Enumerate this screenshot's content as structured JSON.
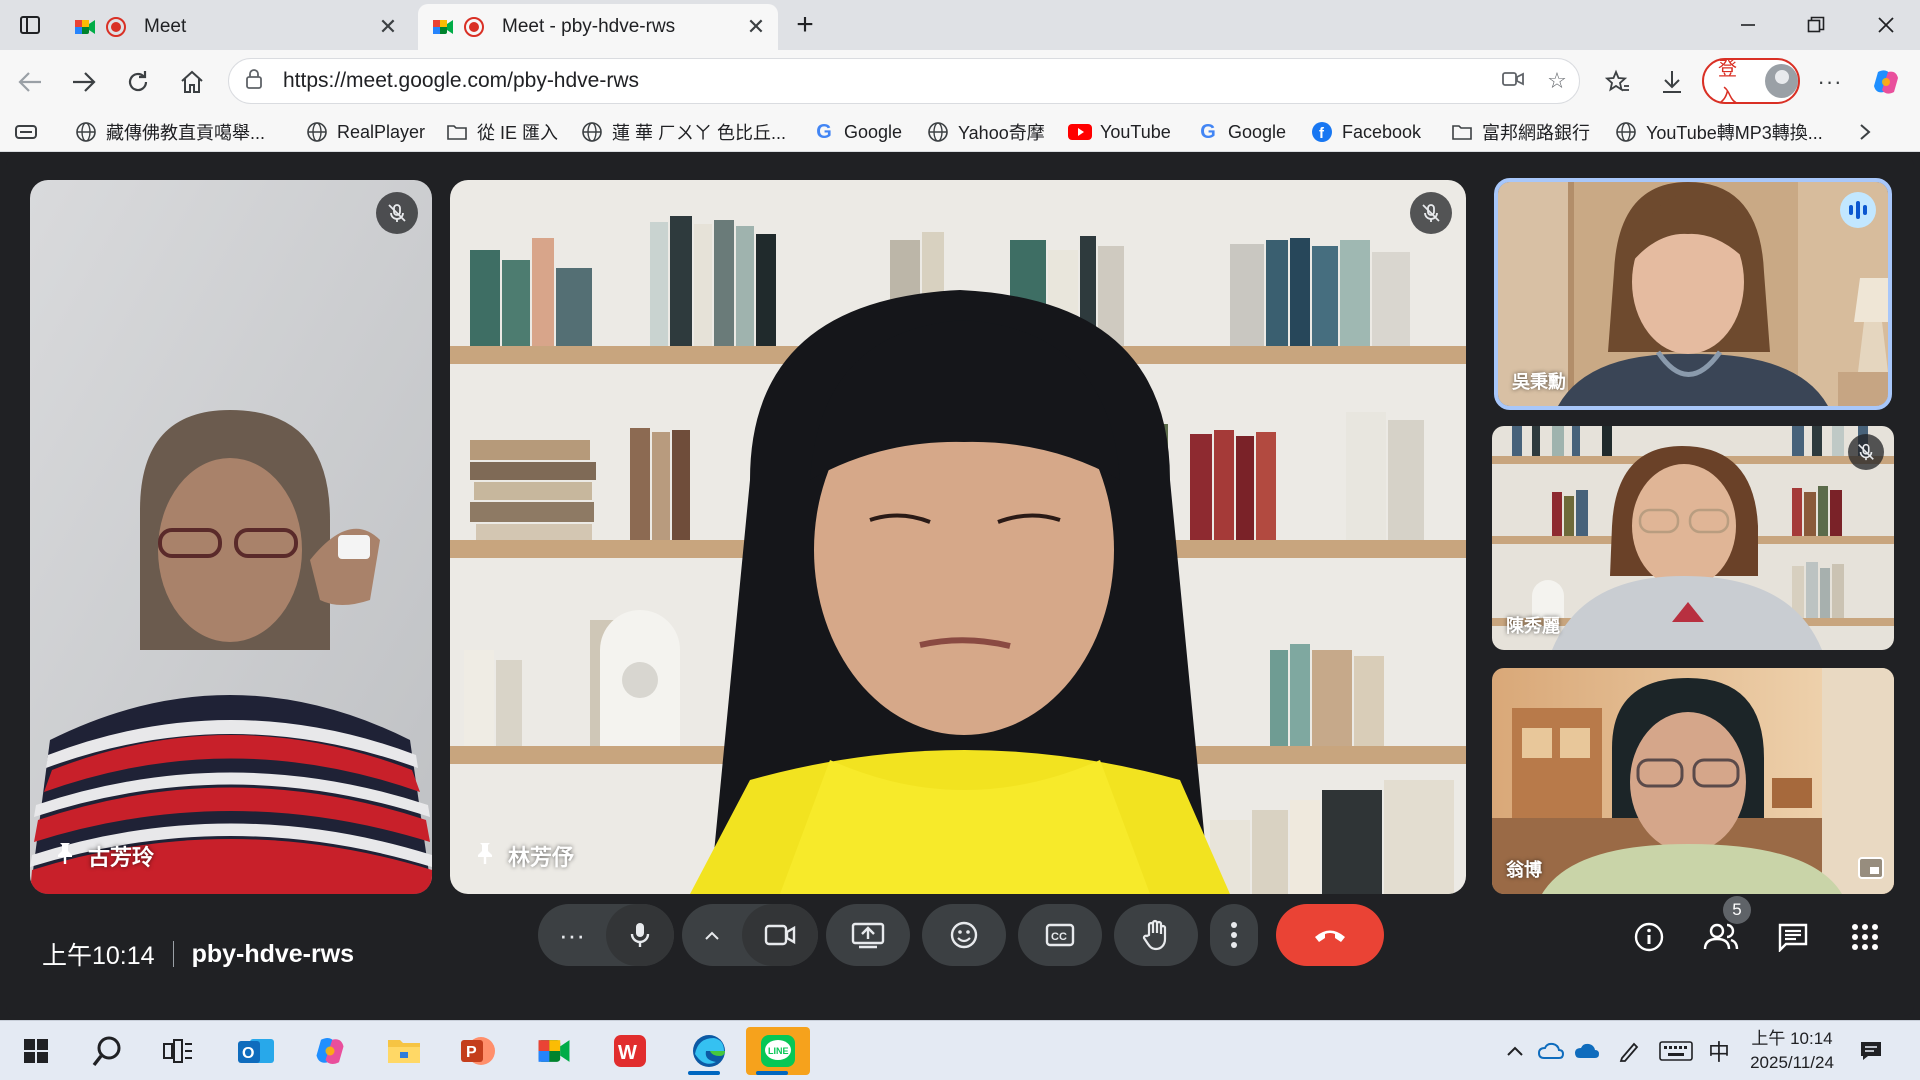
{
  "browser": {
    "tabs": [
      {
        "title": "Meet",
        "active": false
      },
      {
        "title": "Meet - pby-hdve-rws",
        "active": true
      }
    ],
    "url": "https://meet.google.com/pby-hdve-rws",
    "signin_label": "登入",
    "bookmarks": [
      {
        "label": "藏傳佛教直貢噶舉...",
        "icon": "globe-icon"
      },
      {
        "label": "RealPlayer",
        "icon": "globe-icon"
      },
      {
        "label": "從 IE 匯入",
        "icon": "folder-icon"
      },
      {
        "label": "蓮 華 ㄏㄨㄚ 色比丘...",
        "icon": "globe-icon"
      },
      {
        "label": "Google",
        "icon": "google-icon"
      },
      {
        "label": "Yahoo奇摩",
        "icon": "globe-icon"
      },
      {
        "label": "YouTube",
        "icon": "youtube-icon"
      },
      {
        "label": "Google",
        "icon": "google-icon"
      },
      {
        "label": "Facebook",
        "icon": "facebook-icon"
      },
      {
        "label": "富邦網路銀行",
        "icon": "folder-icon"
      },
      {
        "label": "YouTube轉MP3轉換...",
        "icon": "globe-icon"
      }
    ]
  },
  "meet": {
    "participants": [
      {
        "name": "古芳玲",
        "pinned": true,
        "muted": true
      },
      {
        "name": "林芳伃",
        "pinned": true,
        "muted": true
      },
      {
        "name": "吳秉勳",
        "pinned": false,
        "muted": false,
        "speaking": true
      },
      {
        "name": "陳秀麗",
        "pinned": false,
        "muted": true
      },
      {
        "name": "翁博",
        "pinned": false,
        "muted": false
      }
    ],
    "time": "上午10:14",
    "meeting_code": "pby-hdve-rws",
    "people_count": "5",
    "colors": {
      "background": "#202124",
      "control": "#3c4043",
      "end_call": "#ea4335",
      "speaking_outline": "#a8c7fa"
    }
  },
  "taskbar": {
    "ime": "中",
    "clock_time": "上午 10:14",
    "clock_date": "2025/11/24"
  }
}
